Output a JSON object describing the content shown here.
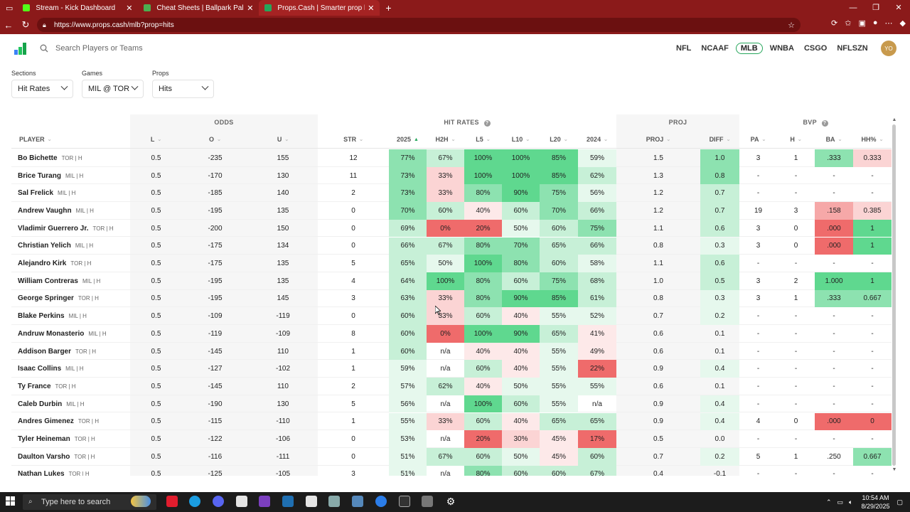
{
  "browser": {
    "tabs": [
      {
        "label": "Stream - Kick Dashboard",
        "color": "#53fc18"
      },
      {
        "label": "Cheat Sheets | Ballpark Pal",
        "color": "#4caf50"
      },
      {
        "label": "Props.Cash | Smarter prop bets. M",
        "color": "#26a65b",
        "active": true
      }
    ],
    "url": "https://www.props.cash/mlb?prop=hits"
  },
  "header": {
    "search_placeholder": "Search Players or Teams",
    "sports": [
      "NFL",
      "NCAAF",
      "MLB",
      "WNBA",
      "CSGO",
      "NFLSZN"
    ],
    "active_sport": "MLB",
    "avatar_initials": "YO"
  },
  "filters": {
    "sections_label": "Sections",
    "sections_value": "Hit Rates",
    "games_label": "Games",
    "games_value": "MIL @ TOR",
    "props_label": "Props",
    "props_value": "Hits"
  },
  "groups": {
    "odds": "ODDS",
    "hit_rates": "HIT RATES",
    "proj": "PROJ",
    "bvp": "BVP"
  },
  "columns": {
    "player": "PLAYER",
    "l": "L",
    "o": "O",
    "u": "U",
    "str": "STR",
    "y2025": "2025",
    "h2h": "H2H",
    "l5": "L5",
    "l10": "L10",
    "l20": "L20",
    "y2024": "2024",
    "proj": "PROJ",
    "diff": "DIFF",
    "pa": "PA",
    "h": "H",
    "ba": "BA",
    "hh": "HH%"
  },
  "rows": [
    {
      "name": "Bo Bichette",
      "team": "TOR | H",
      "l": "0.5",
      "o": "-235",
      "u": "155",
      "str": "12",
      "y2025": "77%",
      "h2h": "67%",
      "l5": "100%",
      "l10": "100%",
      "l20": "85%",
      "y2024": "59%",
      "proj": "1.5",
      "diff": "1.0",
      "pa": "3",
      "h": "1",
      "ba": ".333",
      "hh": "0.333"
    },
    {
      "name": "Brice Turang",
      "team": "MIL | H",
      "l": "0.5",
      "o": "-170",
      "u": "130",
      "str": "11",
      "y2025": "73%",
      "h2h": "33%",
      "l5": "100%",
      "l10": "100%",
      "l20": "85%",
      "y2024": "62%",
      "proj": "1.3",
      "diff": "0.8",
      "pa": "-",
      "h": "-",
      "ba": "-",
      "hh": "-"
    },
    {
      "name": "Sal Frelick",
      "team": "MIL | H",
      "l": "0.5",
      "o": "-185",
      "u": "140",
      "str": "2",
      "y2025": "73%",
      "h2h": "33%",
      "l5": "80%",
      "l10": "90%",
      "l20": "75%",
      "y2024": "56%",
      "proj": "1.2",
      "diff": "0.7",
      "pa": "-",
      "h": "-",
      "ba": "-",
      "hh": "-"
    },
    {
      "name": "Andrew Vaughn",
      "team": "MIL | H",
      "l": "0.5",
      "o": "-195",
      "u": "135",
      "str": "0",
      "y2025": "70%",
      "h2h": "60%",
      "l5": "40%",
      "l10": "60%",
      "l20": "70%",
      "y2024": "66%",
      "proj": "1.2",
      "diff": "0.7",
      "pa": "19",
      "h": "3",
      "ba": ".158",
      "hh": "0.385"
    },
    {
      "name": "Vladimir Guerrero Jr.",
      "team": "TOR | H",
      "l": "0.5",
      "o": "-200",
      "u": "150",
      "str": "0",
      "y2025": "69%",
      "h2h": "0%",
      "l5": "20%",
      "l10": "50%",
      "l20": "60%",
      "y2024": "75%",
      "proj": "1.1",
      "diff": "0.6",
      "pa": "3",
      "h": "0",
      "ba": ".000",
      "hh": "1"
    },
    {
      "name": "Christian Yelich",
      "team": "MIL | H",
      "l": "0.5",
      "o": "-175",
      "u": "134",
      "str": "0",
      "y2025": "66%",
      "h2h": "67%",
      "l5": "80%",
      "l10": "70%",
      "l20": "65%",
      "y2024": "66%",
      "proj": "0.8",
      "diff": "0.3",
      "pa": "3",
      "h": "0",
      "ba": ".000",
      "hh": "1"
    },
    {
      "name": "Alejandro Kirk",
      "team": "TOR | H",
      "l": "0.5",
      "o": "-175",
      "u": "135",
      "str": "5",
      "y2025": "65%",
      "h2h": "50%",
      "l5": "100%",
      "l10": "80%",
      "l20": "60%",
      "y2024": "58%",
      "proj": "1.1",
      "diff": "0.6",
      "pa": "-",
      "h": "-",
      "ba": "-",
      "hh": "-"
    },
    {
      "name": "William Contreras",
      "team": "MIL | H",
      "l": "0.5",
      "o": "-195",
      "u": "135",
      "str": "4",
      "y2025": "64%",
      "h2h": "100%",
      "l5": "80%",
      "l10": "60%",
      "l20": "75%",
      "y2024": "68%",
      "proj": "1.0",
      "diff": "0.5",
      "pa": "3",
      "h": "2",
      "ba": "1.000",
      "hh": "1"
    },
    {
      "name": "George Springer",
      "team": "TOR | H",
      "l": "0.5",
      "o": "-195",
      "u": "145",
      "str": "3",
      "y2025": "63%",
      "h2h": "33%",
      "l5": "80%",
      "l10": "90%",
      "l20": "85%",
      "y2024": "61%",
      "proj": "0.8",
      "diff": "0.3",
      "pa": "3",
      "h": "1",
      "ba": ".333",
      "hh": "0.667"
    },
    {
      "name": "Blake Perkins",
      "team": "MIL | H",
      "l": "0.5",
      "o": "-109",
      "u": "-119",
      "str": "0",
      "y2025": "60%",
      "h2h": "33%",
      "l5": "60%",
      "l10": "40%",
      "l20": "55%",
      "y2024": "52%",
      "proj": "0.7",
      "diff": "0.2",
      "pa": "-",
      "h": "-",
      "ba": "-",
      "hh": "-"
    },
    {
      "name": "Andruw Monasterio",
      "team": "MIL | H",
      "l": "0.5",
      "o": "-119",
      "u": "-109",
      "str": "8",
      "y2025": "60%",
      "h2h": "0%",
      "l5": "100%",
      "l10": "90%",
      "l20": "65%",
      "y2024": "41%",
      "proj": "0.6",
      "diff": "0.1",
      "pa": "-",
      "h": "-",
      "ba": "-",
      "hh": "-"
    },
    {
      "name": "Addison Barger",
      "team": "TOR | H",
      "l": "0.5",
      "o": "-145",
      "u": "110",
      "str": "1",
      "y2025": "60%",
      "h2h": "n/a",
      "l5": "40%",
      "l10": "40%",
      "l20": "55%",
      "y2024": "49%",
      "proj": "0.6",
      "diff": "0.1",
      "pa": "-",
      "h": "-",
      "ba": "-",
      "hh": "-"
    },
    {
      "name": "Isaac Collins",
      "team": "MIL | H",
      "l": "0.5",
      "o": "-127",
      "u": "-102",
      "str": "1",
      "y2025": "59%",
      "h2h": "n/a",
      "l5": "60%",
      "l10": "40%",
      "l20": "55%",
      "y2024": "22%",
      "proj": "0.9",
      "diff": "0.4",
      "pa": "-",
      "h": "-",
      "ba": "-",
      "hh": "-"
    },
    {
      "name": "Ty France",
      "team": "TOR | H",
      "l": "0.5",
      "o": "-145",
      "u": "110",
      "str": "2",
      "y2025": "57%",
      "h2h": "62%",
      "l5": "40%",
      "l10": "50%",
      "l20": "55%",
      "y2024": "55%",
      "proj": "0.6",
      "diff": "0.1",
      "pa": "-",
      "h": "-",
      "ba": "-",
      "hh": "-"
    },
    {
      "name": "Caleb Durbin",
      "team": "MIL | H",
      "l": "0.5",
      "o": "-190",
      "u": "130",
      "str": "5",
      "y2025": "56%",
      "h2h": "n/a",
      "l5": "100%",
      "l10": "60%",
      "l20": "55%",
      "y2024": "n/a",
      "proj": "0.9",
      "diff": "0.4",
      "pa": "-",
      "h": "-",
      "ba": "-",
      "hh": "-"
    },
    {
      "name": "Andres Gimenez",
      "team": "TOR | H",
      "l": "0.5",
      "o": "-115",
      "u": "-110",
      "str": "1",
      "y2025": "55%",
      "h2h": "33%",
      "l5": "60%",
      "l10": "40%",
      "l20": "65%",
      "y2024": "65%",
      "proj": "0.9",
      "diff": "0.4",
      "pa": "4",
      "h": "0",
      "ba": ".000",
      "hh": "0"
    },
    {
      "name": "Tyler Heineman",
      "team": "TOR | H",
      "l": "0.5",
      "o": "-122",
      "u": "-106",
      "str": "0",
      "y2025": "53%",
      "h2h": "n/a",
      "l5": "20%",
      "l10": "30%",
      "l20": "45%",
      "y2024": "17%",
      "proj": "0.5",
      "diff": "0.0",
      "pa": "-",
      "h": "-",
      "ba": "-",
      "hh": "-"
    },
    {
      "name": "Daulton Varsho",
      "team": "TOR | H",
      "l": "0.5",
      "o": "-116",
      "u": "-111",
      "str": "0",
      "y2025": "51%",
      "h2h": "67%",
      "l5": "60%",
      "l10": "50%",
      "l20": "45%",
      "y2024": "60%",
      "proj": "0.7",
      "diff": "0.2",
      "pa": "5",
      "h": "1",
      "ba": ".250",
      "hh": "0.667"
    },
    {
      "name": "Nathan Lukes",
      "team": "TOR | H",
      "l": "0.5",
      "o": "-125",
      "u": "-105",
      "str": "3",
      "y2025": "51%",
      "h2h": "n/a",
      "l5": "80%",
      "l10": "60%",
      "l20": "60%",
      "y2024": "67%",
      "proj": "0.4",
      "diff": "-0.1",
      "pa": "-",
      "h": "-",
      "ba": "-",
      "hh": "-"
    }
  ],
  "taskbar": {
    "search_placeholder": "Type here to search",
    "time": "10:54 AM",
    "date": "8/29/2025"
  },
  "colors": {
    "green_strong": "#5fd88f",
    "green_mid": "#8de2b0",
    "green_light": "#c7f0d7",
    "green_faint": "#e6f8ed",
    "red_strong": "#ef6b6b",
    "red_mid": "#f6a8a8",
    "red_light": "#fbd4d4",
    "red_faint": "#fde9e9"
  }
}
